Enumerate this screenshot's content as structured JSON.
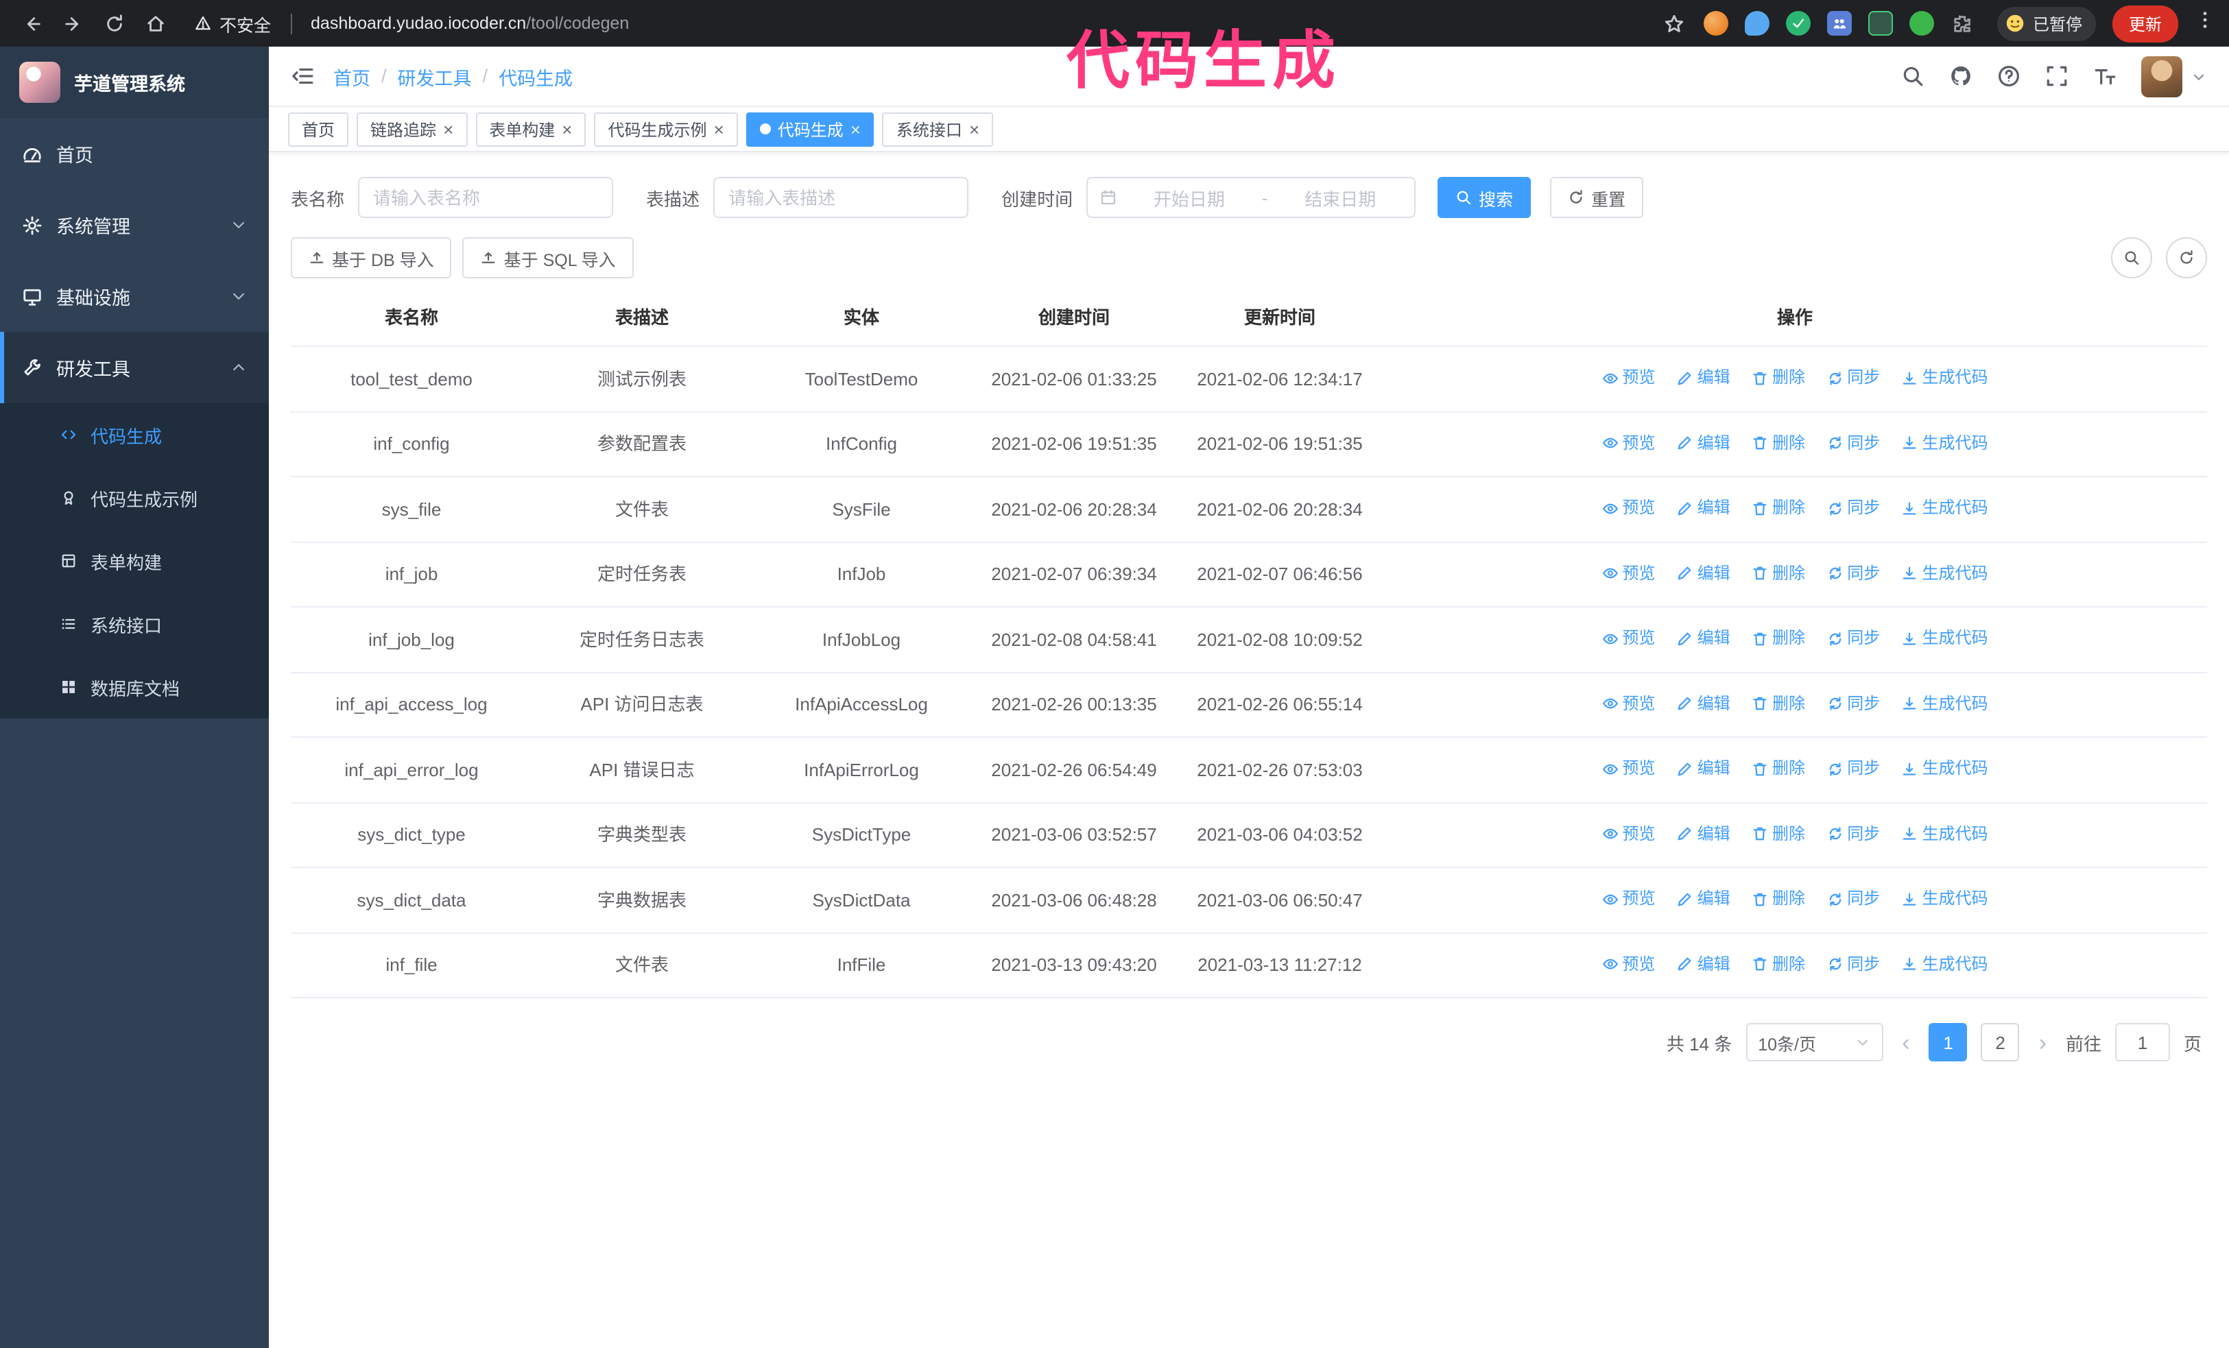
{
  "colors": {
    "accent": "#409eff",
    "annotation_pink": "#ff3b80",
    "update_red": "#d93025",
    "sidebar_bg": "#304156",
    "submenu_bg": "#1f2d3d"
  },
  "glyphs": {
    "close": "×",
    "prev": "‹",
    "next": "›"
  },
  "browser": {
    "security_label": "不安全",
    "url_host": "dashboard.yudao.iocoder.cn",
    "url_path": "/tool/codegen",
    "paused_label": "已暂停",
    "update_label": "更新"
  },
  "annotation": {
    "text": "代码生成",
    "color": "#ff3b80"
  },
  "sidebar": {
    "logo_title": "芋道管理系统",
    "items": [
      {
        "label": "首页"
      },
      {
        "label": "系统管理"
      },
      {
        "label": "基础设施"
      },
      {
        "label": "研发工具"
      }
    ],
    "sub_items": [
      {
        "label": "代码生成",
        "active": true
      },
      {
        "label": "代码生成示例"
      },
      {
        "label": "表单构建"
      },
      {
        "label": "系统接口"
      },
      {
        "label": "数据库文档"
      }
    ]
  },
  "header": {
    "breadcrumb": [
      "首页",
      "研发工具",
      "代码生成"
    ],
    "breadcrumb_separator": "/"
  },
  "tabs": [
    {
      "label": "首页",
      "closable": false,
      "active": false
    },
    {
      "label": "链路追踪",
      "closable": true,
      "active": false
    },
    {
      "label": "表单构建",
      "closable": true,
      "active": false
    },
    {
      "label": "代码生成示例",
      "closable": true,
      "active": false
    },
    {
      "label": "代码生成",
      "closable": true,
      "active": true
    },
    {
      "label": "系统接口",
      "closable": true,
      "active": false
    }
  ],
  "filters": {
    "table_name_label": "表名称",
    "table_name_placeholder": "请输入表名称",
    "table_desc_label": "表描述",
    "table_desc_placeholder": "请输入表描述",
    "create_time_label": "创建时间",
    "start_date_placeholder": "开始日期",
    "range_separator": "-",
    "end_date_placeholder": "结束日期",
    "search_label": "搜索",
    "reset_label": "重置"
  },
  "toolbar": {
    "import_db_label": "基于 DB 导入",
    "import_sql_label": "基于 SQL 导入"
  },
  "table": {
    "columns": [
      "表名称",
      "表描述",
      "实体",
      "创建时间",
      "更新时间",
      "操作"
    ],
    "actions": [
      "预览",
      "编辑",
      "删除",
      "同步",
      "生成代码"
    ],
    "rows": [
      {
        "name": "tool_test_demo",
        "desc": "测试示例表",
        "entity": "ToolTestDemo",
        "created": "2021-02-06 01:33:25",
        "updated": "2021-02-06 12:34:17"
      },
      {
        "name": "inf_config",
        "desc": "参数配置表",
        "entity": "InfConfig",
        "created": "2021-02-06 19:51:35",
        "updated": "2021-02-06 19:51:35"
      },
      {
        "name": "sys_file",
        "desc": "文件表",
        "entity": "SysFile",
        "created": "2021-02-06 20:28:34",
        "updated": "2021-02-06 20:28:34"
      },
      {
        "name": "inf_job",
        "desc": "定时任务表",
        "entity": "InfJob",
        "created": "2021-02-07 06:39:34",
        "updated": "2021-02-07 06:46:56"
      },
      {
        "name": "inf_job_log",
        "desc": "定时任务日志表",
        "entity": "InfJobLog",
        "created": "2021-02-08 04:58:41",
        "updated": "2021-02-08 10:09:52"
      },
      {
        "name": "inf_api_access_log",
        "desc": "API 访问日志表",
        "entity": "InfApiAccessLog",
        "created": "2021-02-26 00:13:35",
        "updated": "2021-02-26 06:55:14"
      },
      {
        "name": "inf_api_error_log",
        "desc": "API 错误日志",
        "entity": "InfApiErrorLog",
        "created": "2021-02-26 06:54:49",
        "updated": "2021-02-26 07:53:03"
      },
      {
        "name": "sys_dict_type",
        "desc": "字典类型表",
        "entity": "SysDictType",
        "created": "2021-03-06 03:52:57",
        "updated": "2021-03-06 04:03:52"
      },
      {
        "name": "sys_dict_data",
        "desc": "字典数据表",
        "entity": "SysDictData",
        "created": "2021-03-06 06:48:28",
        "updated": "2021-03-06 06:50:47"
      },
      {
        "name": "inf_file",
        "desc": "文件表",
        "entity": "InfFile",
        "created": "2021-03-13 09:43:20",
        "updated": "2021-03-13 11:27:12"
      }
    ]
  },
  "pagination": {
    "total": "共 14 条",
    "page_size": "10条/页",
    "pages": [
      "1",
      "2"
    ],
    "goto_label": "前往",
    "goto_value": "1",
    "page_suffix": "页"
  }
}
